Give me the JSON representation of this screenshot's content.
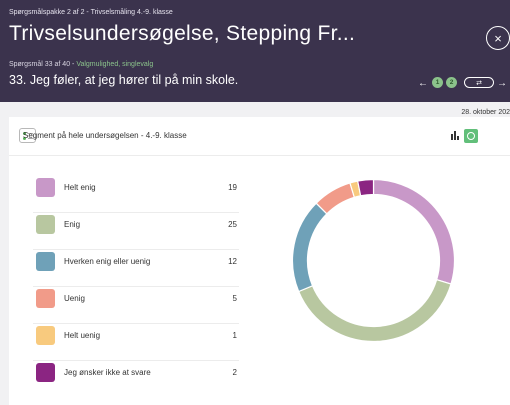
{
  "header": {
    "package_label": "Spørgsmålspakke 2 af 2 - Trivselsmåling 4.-9. klasse",
    "survey_title": "Trivselsundersøgelse, Stepping Fr...",
    "question_counter": "Spørgsmål 33 af 40 - ",
    "question_type": "Valgmulighed, singlevalg",
    "question_text": "33. Jeg føler, at jeg hører til på min skole.",
    "nav_prev": "←",
    "page_dot_1": "1",
    "page_dot_2": "2",
    "nav_next": "→",
    "close": "×"
  },
  "date": "28. oktober 202",
  "segment": {
    "title": "Segment på hele undersøgelsen  - 4.-9. klasse"
  },
  "chart_data": {
    "type": "pie",
    "style": "donut",
    "title": "",
    "categories": [
      "Helt enig",
      "Enig",
      "Hverken enig eller uenig",
      "Uenig",
      "Helt uenig",
      "Jeg ønsker ikke at svare"
    ],
    "values": [
      19,
      25,
      12,
      5,
      1,
      2
    ],
    "colors": [
      "#c898c8",
      "#b8c7a0",
      "#6fa1b8",
      "#f19b89",
      "#f8ca7e",
      "#8b2582"
    ],
    "legend": [
      {
        "label": "Helt enig",
        "value": "19"
      },
      {
        "label": "Enig",
        "value": "25"
      },
      {
        "label": "Hverken enig eller uenig",
        "value": "12"
      },
      {
        "label": "Uenig",
        "value": "5"
      },
      {
        "label": "Helt uenig",
        "value": "1"
      },
      {
        "label": "Jeg ønsker ikke at svare",
        "value": "2"
      }
    ]
  }
}
